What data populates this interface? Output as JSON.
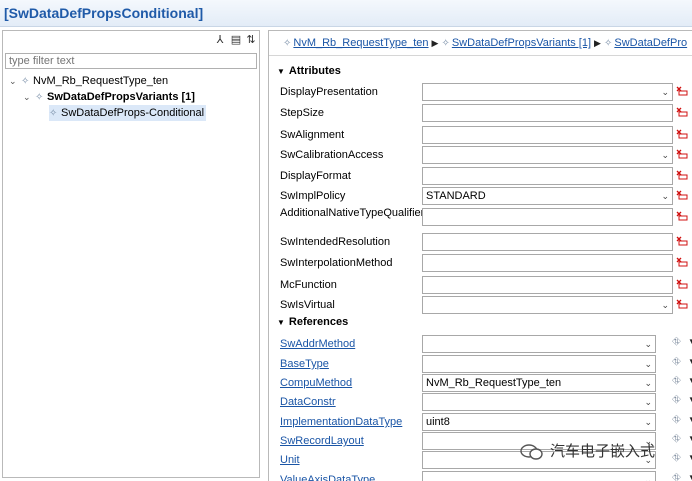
{
  "window": {
    "title": "[SwDataDefPropsConditional]"
  },
  "left_toolbar": [
    {
      "name": "collapse-icon",
      "glyph": "⅄"
    },
    {
      "name": "document-icon",
      "glyph": "▤"
    },
    {
      "name": "sort-icon",
      "glyph": "⇅"
    }
  ],
  "filter": {
    "placeholder": "type filter text",
    "value": ""
  },
  "tree": [
    {
      "label": "NvM_Rb_RequestType_ten",
      "bold": false,
      "twisty": "⌄",
      "selected": false
    },
    {
      "label": "SwDataDefPropsVariants [1]",
      "bold": true,
      "twisty": "⌄",
      "selected": false
    },
    {
      "label": "SwDataDefProps-Conditional",
      "bold": false,
      "twisty": "",
      "selected": true
    }
  ],
  "breadcrumb": [
    "NvM_Rb_RequestType_ten",
    "SwDataDefPropsVariants [1]",
    "SwDataDefPro"
  ],
  "sections": {
    "attributes": "Attributes",
    "references": "References"
  },
  "attributes": [
    {
      "label": "DisplayPresentation",
      "value": "",
      "type": "combo"
    },
    {
      "label": "StepSize",
      "value": "",
      "type": "text"
    },
    {
      "label": "SwAlignment",
      "value": "",
      "type": "text"
    },
    {
      "label": "SwCalibrationAccess",
      "value": "",
      "type": "combo"
    },
    {
      "label": "DisplayFormat",
      "value": "",
      "type": "text"
    },
    {
      "label": "SwImplPolicy",
      "value": "STANDARD",
      "type": "combo"
    },
    {
      "label": "AdditionalNativeTypeQualifier",
      "value": "",
      "type": "text"
    },
    {
      "label": "SwIntendedResolution",
      "value": "",
      "type": "text"
    },
    {
      "label": "SwInterpolationMethod",
      "value": "",
      "type": "text"
    },
    {
      "label": "McFunction",
      "value": "",
      "type": "text"
    },
    {
      "label": "SwIsVirtual",
      "value": "",
      "type": "combo"
    }
  ],
  "references": [
    {
      "label": "SwAddrMethod",
      "value": ""
    },
    {
      "label": "BaseType",
      "value": ""
    },
    {
      "label": "CompuMethod",
      "value": "NvM_Rb_RequestType_ten"
    },
    {
      "label": "DataConstr",
      "value": ""
    },
    {
      "label": "ImplementationDataType",
      "value": "uint8"
    },
    {
      "label": "SwRecordLayout",
      "value": ""
    },
    {
      "label": "Unit",
      "value": ""
    },
    {
      "label": "ValueAxisDataType",
      "value": ""
    }
  ],
  "watermark": {
    "text": "汽车电子嵌入式"
  },
  "colors": {
    "link": "#1a55a6",
    "title": "#1f5aa8",
    "selection": "#dbe8f8",
    "delete_icon": "#d01010"
  }
}
